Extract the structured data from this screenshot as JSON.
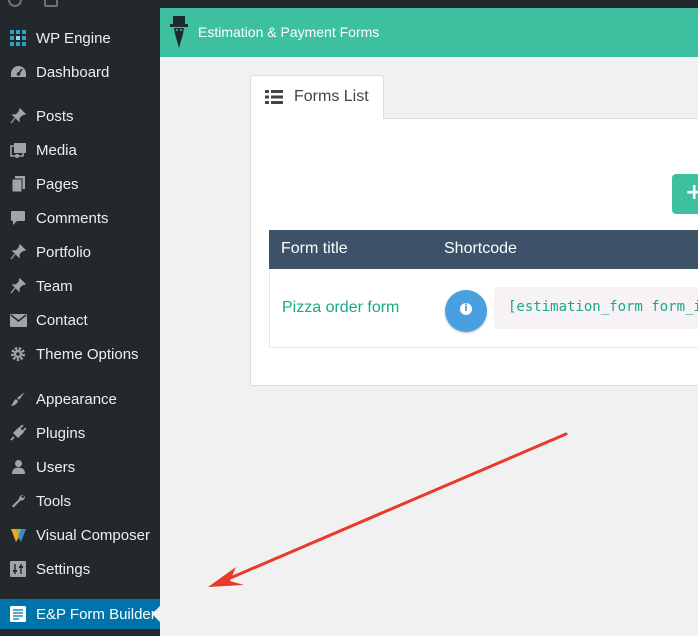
{
  "sidebar": {
    "items": [
      {
        "label": "WP Engine",
        "icon": "wp-engine-icon"
      },
      {
        "label": "Dashboard",
        "icon": "dashboard-icon"
      },
      {
        "label": "Posts",
        "icon": "pin-icon"
      },
      {
        "label": "Media",
        "icon": "media-icon"
      },
      {
        "label": "Pages",
        "icon": "pages-icon"
      },
      {
        "label": "Comments",
        "icon": "comments-icon"
      },
      {
        "label": "Portfolio",
        "icon": "pin-icon"
      },
      {
        "label": "Team",
        "icon": "pin-icon"
      },
      {
        "label": "Contact",
        "icon": "mail-icon"
      },
      {
        "label": "Theme Options",
        "icon": "gear-icon"
      },
      {
        "label": "Appearance",
        "icon": "brush-icon"
      },
      {
        "label": "Plugins",
        "icon": "plugin-icon"
      },
      {
        "label": "Users",
        "icon": "user-icon"
      },
      {
        "label": "Tools",
        "icon": "wrench-icon"
      },
      {
        "label": "Visual Composer",
        "icon": "visual-composer-icon"
      },
      {
        "label": "Settings",
        "icon": "settings-icon"
      },
      {
        "label": "E&P Form Builder",
        "icon": "form-icon",
        "active": true
      }
    ]
  },
  "header": {
    "title": "Estimation & Payment Forms",
    "color": "#3cc0a0"
  },
  "tabs": [
    {
      "label": "Forms List",
      "icon": "list-icon"
    }
  ],
  "toolbar": {
    "add_label": "+"
  },
  "table": {
    "columns": [
      "Form title",
      "Shortcode"
    ],
    "rows": [
      {
        "title": "Pizza order form",
        "shortcode": "[estimation_form form_id"
      }
    ]
  },
  "colors": {
    "accent": "#3cc0a0",
    "sidebar": "#23282d",
    "active": "#0073aa",
    "table_header": "#3d5269",
    "info": "#4a9fe0",
    "annotation": "#e8392a"
  }
}
